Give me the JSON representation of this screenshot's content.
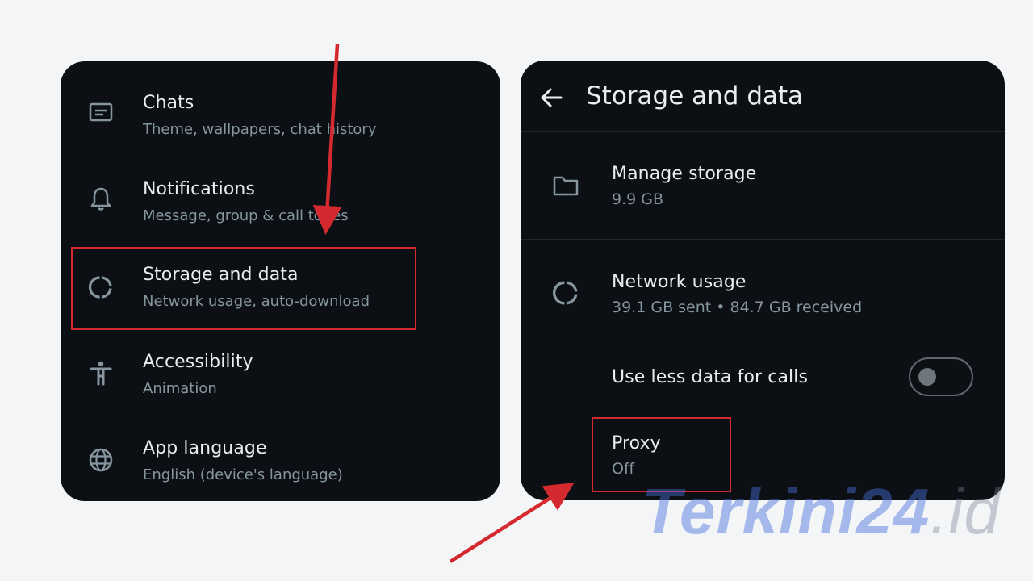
{
  "left_settings": {
    "items": [
      {
        "title": "Chats",
        "subtitle": "Theme, wallpapers, chat history",
        "icon": "chat-icon"
      },
      {
        "title": "Notifications",
        "subtitle": "Message, group & call tones",
        "icon": "bell-icon"
      },
      {
        "title": "Storage and data",
        "subtitle": "Network usage, auto-download",
        "icon": "data-usage-icon"
      },
      {
        "title": "Accessibility",
        "subtitle": "Animation",
        "icon": "accessibility-icon"
      },
      {
        "title": "App language",
        "subtitle": "English (device's language)",
        "icon": "globe-icon"
      }
    ]
  },
  "storage_screen": {
    "title": "Storage and data",
    "manage_storage": {
      "title": "Manage storage",
      "subtitle": "9.9 GB"
    },
    "network_usage": {
      "title": "Network usage",
      "subtitle": "39.1 GB sent • 84.7 GB received"
    },
    "less_data_calls": {
      "label": "Use less data for calls",
      "enabled": false
    },
    "proxy": {
      "title": "Proxy",
      "subtitle": "Off"
    }
  },
  "watermark": {
    "brand": "Terkini",
    "number": "24",
    "suffix": ".id"
  },
  "colors": {
    "background": "#f3f5f7",
    "panel": "#0c1014",
    "highlight": "#d42a2f",
    "arrow": "#d42a2f"
  }
}
